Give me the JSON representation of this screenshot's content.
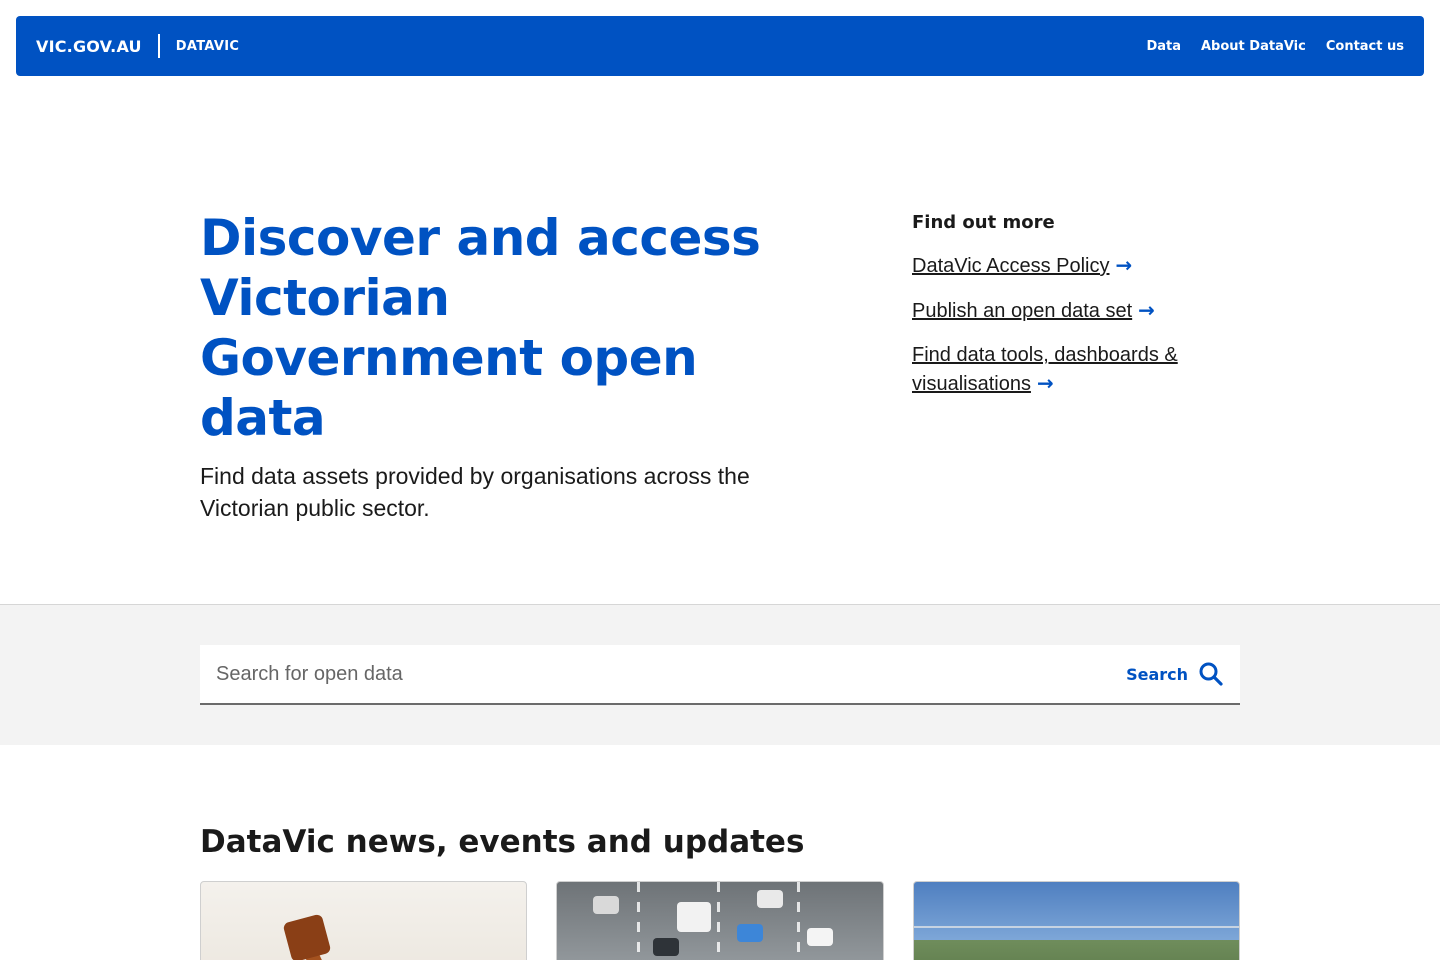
{
  "header": {
    "brand_primary": "VIC.GOV.AU",
    "brand_site": "DATAVIC",
    "nav": [
      "Data",
      "About DataVic",
      "Contact us"
    ],
    "bg_color": "#0052c2"
  },
  "hero": {
    "title": "Discover and access Victorian Government open data",
    "subtitle": "Find data assets provided by organisations across the Victorian public sector."
  },
  "find_out_more": {
    "title": "Find out more",
    "links": [
      {
        "label": "DataVic Access Policy",
        "icon": "arrow-right-icon"
      },
      {
        "label": "Publish an open data set",
        "icon": "arrow-right-icon"
      },
      {
        "label": "Find data tools, dashboards & visualisations",
        "icon": "arrow-right-icon"
      }
    ]
  },
  "search": {
    "placeholder": "Search for open data",
    "button_label": "Search",
    "icon": "search-icon"
  },
  "news": {
    "title": "DataVic news, events and updates",
    "cards": [
      {
        "image": "gavel"
      },
      {
        "image": "highway-traffic"
      },
      {
        "image": "aerial-landscape"
      }
    ]
  }
}
